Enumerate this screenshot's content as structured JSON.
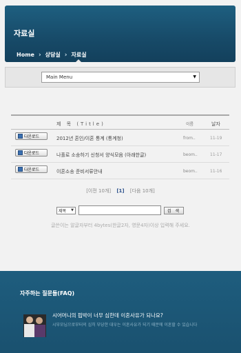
{
  "header": {
    "title": "자료실",
    "breadcrumb": [
      "Home",
      "상담실",
      "자료실"
    ]
  },
  "menu": {
    "selected": "Main Menu"
  },
  "table": {
    "headers": {
      "title": "제 목 (Title)",
      "name": "이름",
      "date": "날자"
    },
    "download_label": "다운로드",
    "rows": [
      {
        "title": "2012년 혼인/이혼 통계 (통계청)",
        "name": "from..",
        "date": "11-19"
      },
      {
        "title": "나홀로 소송하기 신청서 양식모음 (아래한글)",
        "name": "beom..",
        "date": "11-17"
      },
      {
        "title": "이혼소송 준비서류안내",
        "name": "beom..",
        "date": "11-16"
      }
    ]
  },
  "pager": {
    "prev": "[이전 10개]",
    "current": "[1]",
    "next": "[다음 10개]"
  },
  "search": {
    "field": "제목",
    "value": "",
    "button": "검 색"
  },
  "notice": "글쓴이는 알글자부터 4bytes(한글2자, 영문4자)이상 입력해 주세요.",
  "faq": {
    "title": "자주하는 질문들(FAQ)",
    "item": {
      "question": "시어머니의 핍박이 너무 심한데 이혼사유가 되나요?",
      "answer": "시부모님으로부터의 심히 부당한 대우는 이혼사유가 되기 때문에 이혼할 수 있습니다"
    }
  },
  "colors": {
    "header_bg": "#1a5272",
    "faq_bg": "#1e5d7e",
    "accent": "#2a4f8a"
  }
}
